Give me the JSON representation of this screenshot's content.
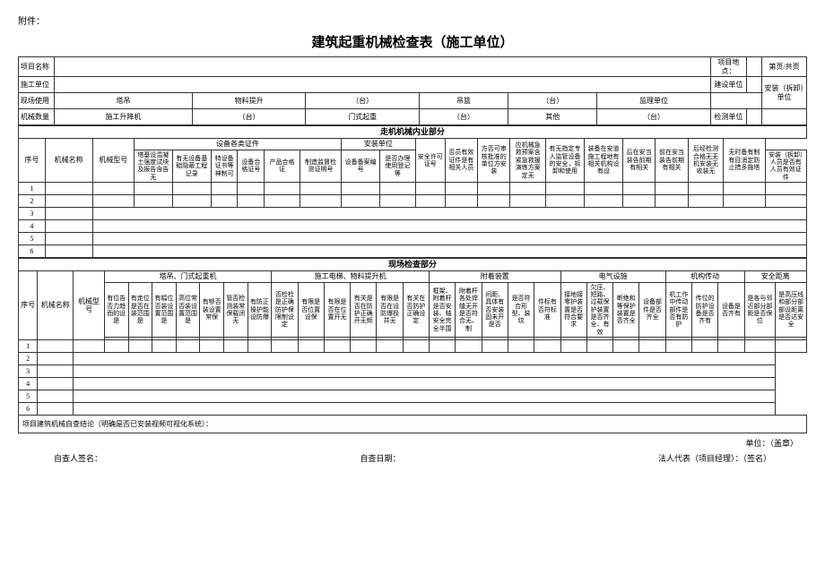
{
  "attachment": "附件：",
  "title": "建筑起重机械检查表（施工单位）",
  "header": {
    "project_name_label": "项目名称",
    "project_location_label": "项目地点：",
    "page_label": "第页/共页",
    "construction_unit_label": "施工单位",
    "build_unit_label": "建设单位",
    "site_use_label": "现场使用",
    "tower_label": "塔吊",
    "material_hoist_label": "物料提升",
    "unit_tai": "（台）",
    "crane_label": "吊篮",
    "supervisor_unit_label": "监理单位",
    "count_label": "机械数量",
    "construction_lift_label": "施工升降机",
    "gate_crane_label": "门式起重",
    "other_label": "其他",
    "inspection_unit_label": "检测单位",
    "install_unit_label": "安装（拆卸）单位"
  },
  "sections": {
    "walk_section": "走机机械内业部分",
    "site_section": "现场检查部分"
  },
  "upper_table": {
    "cols": [
      "序号",
      "机械名称",
      "机械型号",
      "塔基设\n混凝土\n强度试\n块及及\n报告含\n告无",
      "有无设备\n基础隐蔽\n工程记录",
      "特设\n备证\n书等\n神制\n可",
      "设备\n合格\n证号",
      "产品合格\n证",
      "制造监督\n检测证明\n号",
      "设备备案\n编号",
      "是否办理\n使用登记\n等",
      "安装（拆卸）人员\n是否有人\n员有效证件",
      "安全许可证\n号",
      "否员\n有效\n证件\n是有\n相关\n人员",
      "方否\n可审\n核批\n准的\n单位\n方安\n装",
      "应机械\n急救预\n案含紧\n急救援\n演练方\n案定无",
      "有无指定\n专人监管\n设备的安\n全，拆卸\n和使用",
      "装备在\n安道施\n工程地\n有相关\n机构设\n有设",
      "后在\n安当\n装告\n前期\n有相\n关",
      "前在\n安当\n装告\n前期\n有相\n关",
      "后经\n检测\n合格\n无无\n机安\n装无\n收装\n无",
      "无时备\n有制有\n目消定\n防止\n措多\n施塔"
    ],
    "rows": [
      "1",
      "2",
      "3",
      "4",
      "5",
      "6"
    ]
  },
  "lower_table": {
    "groups": {
      "tower_gate": "塔吊、门式起重机",
      "construction_lift": "施工电梯、物料提升机",
      "attachment": "附着装置",
      "electrical": "电气设施",
      "mechanism": "机构传动",
      "safety_distance": "安全距离"
    },
    "rows": [
      "1",
      "2",
      "3",
      "4",
      "5",
      "6"
    ]
  },
  "conclusion_label": "项目建筑机械自查结论（明确是否已安装视频可视化系统）：",
  "footer": {
    "unit_label": "单位：（盖章）",
    "inspector_label": "自查人签名：",
    "date_label": "自查日期：",
    "legal_label": "法人代表（项目经理）：（签名）"
  }
}
